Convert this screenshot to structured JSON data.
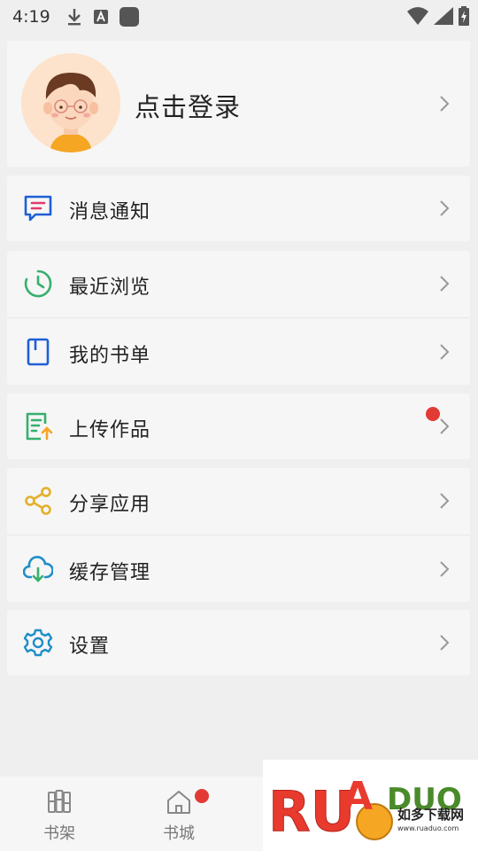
{
  "status_bar": {
    "time": "4:19"
  },
  "profile": {
    "login_label": "点击登录"
  },
  "menu": {
    "messages": "消息通知",
    "recent": "最近浏览",
    "booklist": "我的书单",
    "upload": "上传作品",
    "share": "分享应用",
    "cache": "缓存管理",
    "settings": "设置"
  },
  "bottom_nav": {
    "shelf": "书架",
    "store": "书城"
  },
  "watermark": {
    "brand": "RUANDUO",
    "cn": "如多下载网",
    "url": "www.ruaduo.com"
  },
  "colors": {
    "messages_icon": "#1f5fd6",
    "recent_icon": "#35b06d",
    "booklist_icon": "#1f5fd6",
    "upload_icon": "#35b06d",
    "share_icon": "#e3b02a",
    "cache_icon": "#1f8ec9",
    "settings_icon": "#1f8ec9",
    "badge": "#e23b35"
  }
}
